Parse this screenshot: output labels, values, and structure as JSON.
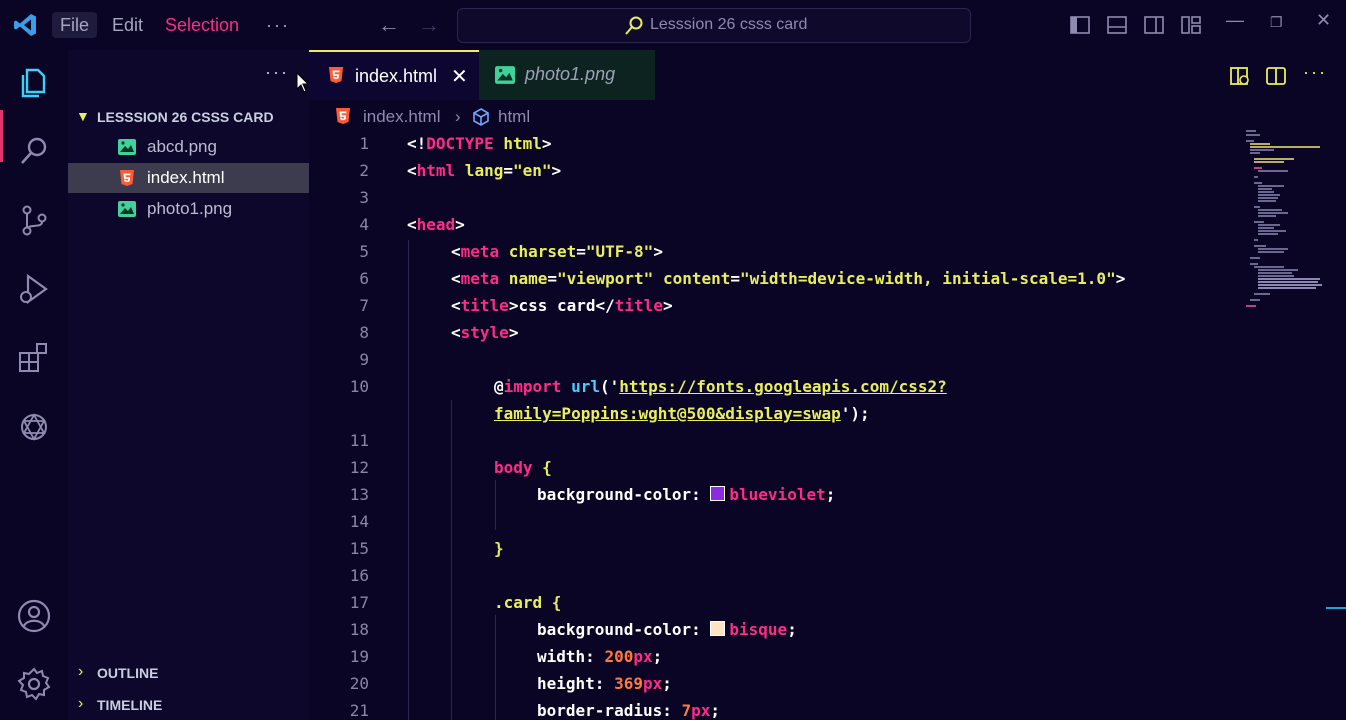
{
  "menu": {
    "file": "File",
    "edit": "Edit",
    "selection": "Selection",
    "more": "···"
  },
  "search": {
    "text": "Lesssion 26 csss card"
  },
  "window": {
    "minimize": "—",
    "restore": "❐",
    "close": "✕"
  },
  "explorer": {
    "more": "···",
    "folder": "LESSSION 26 CSSS CARD",
    "files": [
      {
        "name": "abcd.png",
        "type": "image"
      },
      {
        "name": "index.html",
        "type": "html",
        "selected": true
      },
      {
        "name": "photo1.png",
        "type": "image"
      }
    ],
    "outline": "OUTLINE",
    "timeline": "TIMELINE"
  },
  "tabs": [
    {
      "label": "index.html",
      "active": true,
      "close": "✕"
    },
    {
      "label": "photo1.png",
      "active": false
    }
  ],
  "breadcrumb": {
    "file": "index.html",
    "sep": "›",
    "node": "html"
  },
  "code": {
    "line_numbers": [
      "1",
      "2",
      "3",
      "4",
      "5",
      "6",
      "7",
      "8",
      "9",
      "10",
      "11",
      "12",
      "13",
      "14",
      "15",
      "16",
      "17",
      "18",
      "19",
      "20",
      "21"
    ],
    "l1_a": "<!",
    "l1_b": "DOCTYPE",
    "l1_c": " html",
    "l1_d": ">",
    "l2_a": "<",
    "l2_b": "html",
    "l2_c": " lang",
    "l2_d": "=",
    "l2_e": "\"en\"",
    "l2_f": ">",
    "l4_a": "<",
    "l4_b": "head",
    "l4_c": ">",
    "l5_a": "<",
    "l5_b": "meta",
    "l5_c": " charset",
    "l5_d": "=",
    "l5_e": "\"UTF-8\"",
    "l5_f": ">",
    "l6_a": "<",
    "l6_b": "meta",
    "l6_c": " name",
    "l6_d": "=",
    "l6_e": "\"viewport\"",
    "l6_f": " content",
    "l6_g": "=",
    "l6_h": "\"width=device-width, initial-scale=1.0\"",
    "l6_i": ">",
    "l7_a": "<",
    "l7_b": "title",
    "l7_c": ">css card</",
    "l7_d": "title",
    "l7_e": ">",
    "l8_a": "<",
    "l8_b": "style",
    "l8_c": ">",
    "l10_a": "@",
    "l10_b": "import",
    "l10_c": " url",
    "l10_d": "('",
    "l10_e": "https://fonts.googleapis.com/css2?",
    "l10w_a": "family=Poppins:wght@500&display=swap",
    "l10w_b": "');",
    "l12_a": "body",
    "l12_b": " {",
    "l13_a": "background-color: ",
    "l13_b": "blueviolet",
    "l13_c": ";",
    "l15_a": "}",
    "l17_a": ".card",
    "l17_b": " {",
    "l18_a": "background-color: ",
    "l18_b": "bisque",
    "l18_c": ";",
    "l19_a": "width: ",
    "l19_b": "200",
    "l19_c": "px",
    "l19_d": ";",
    "l20_a": "height: ",
    "l20_b": "369",
    "l20_c": "px",
    "l20_d": ";",
    "l21_a": "border-radius: ",
    "l21_b": "7",
    "l21_c": "px",
    "l21_d": ";"
  },
  "colors": {
    "accent": "#e9ef5c",
    "tag": "#ff2b88",
    "blueviolet": "#8a2be2",
    "bisque": "#ffe4c4",
    "background": "#0a0524"
  }
}
